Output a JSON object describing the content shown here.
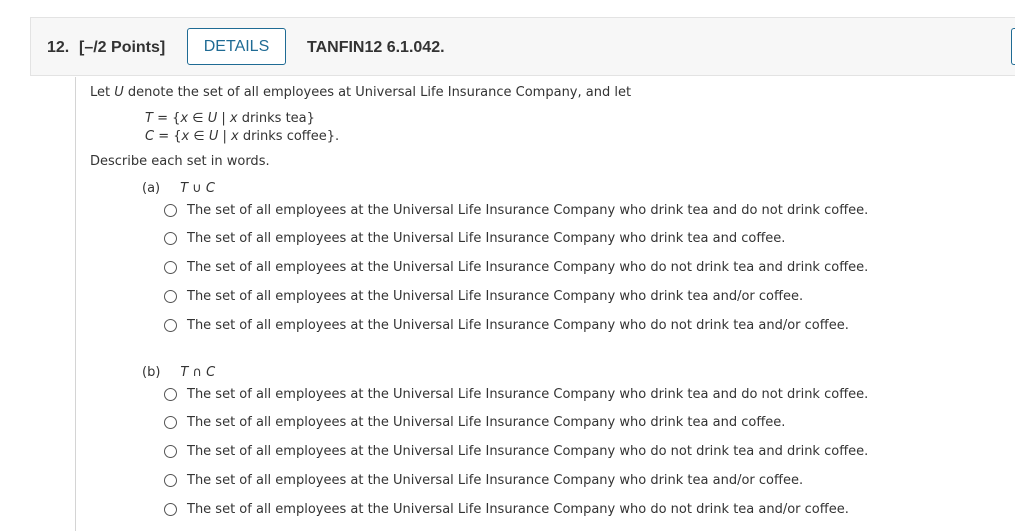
{
  "header": {
    "question_number": "12.",
    "points": "[–/2 Points]",
    "details_label": "DETAILS",
    "question_code": "TANFIN12 6.1.042."
  },
  "problem": {
    "intro_pre": "Let ",
    "intro_var": "U",
    "intro_post": " denote the set of all employees at Universal Life Insurance Company, and let",
    "set_t": {
      "name": "T",
      "eq": " = {",
      "x": "x",
      "member": " ∈ ",
      "u": "U",
      "bar": " | ",
      "x2": "x",
      "cond": " drinks tea}"
    },
    "set_c": {
      "name": "C",
      "eq": " = {",
      "x": "x",
      "member": " ∈ ",
      "u": "U",
      "bar": " | ",
      "x2": "x",
      "cond": " drinks coffee}."
    },
    "instruction": "Describe each set in words."
  },
  "parts": [
    {
      "label": "(a)",
      "expr_left": "T",
      "expr_op": " ∪ ",
      "expr_right": "C",
      "options": [
        "The set of all employees at the Universal Life Insurance Company who drink tea and do not drink coffee.",
        "The set of all employees at the Universal Life Insurance Company who drink tea and coffee.",
        "The set of all employees at the Universal Life Insurance Company who do not drink tea and drink coffee.",
        "The set of all employees at the Universal Life Insurance Company who drink tea and/or coffee.",
        "The set of all employees at the Universal Life Insurance Company who do not drink tea and/or coffee."
      ]
    },
    {
      "label": "(b)",
      "expr_left": "T",
      "expr_op": " ∩ ",
      "expr_right": "C",
      "options": [
        "The set of all employees at the Universal Life Insurance Company who drink tea and do not drink coffee.",
        "The set of all employees at the Universal Life Insurance Company who drink tea and coffee.",
        "The set of all employees at the Universal Life Insurance Company who do not drink tea and drink coffee.",
        "The set of all employees at the Universal Life Insurance Company who drink tea and/or coffee.",
        "The set of all employees at the Universal Life Insurance Company who do not drink tea and/or coffee."
      ]
    }
  ]
}
